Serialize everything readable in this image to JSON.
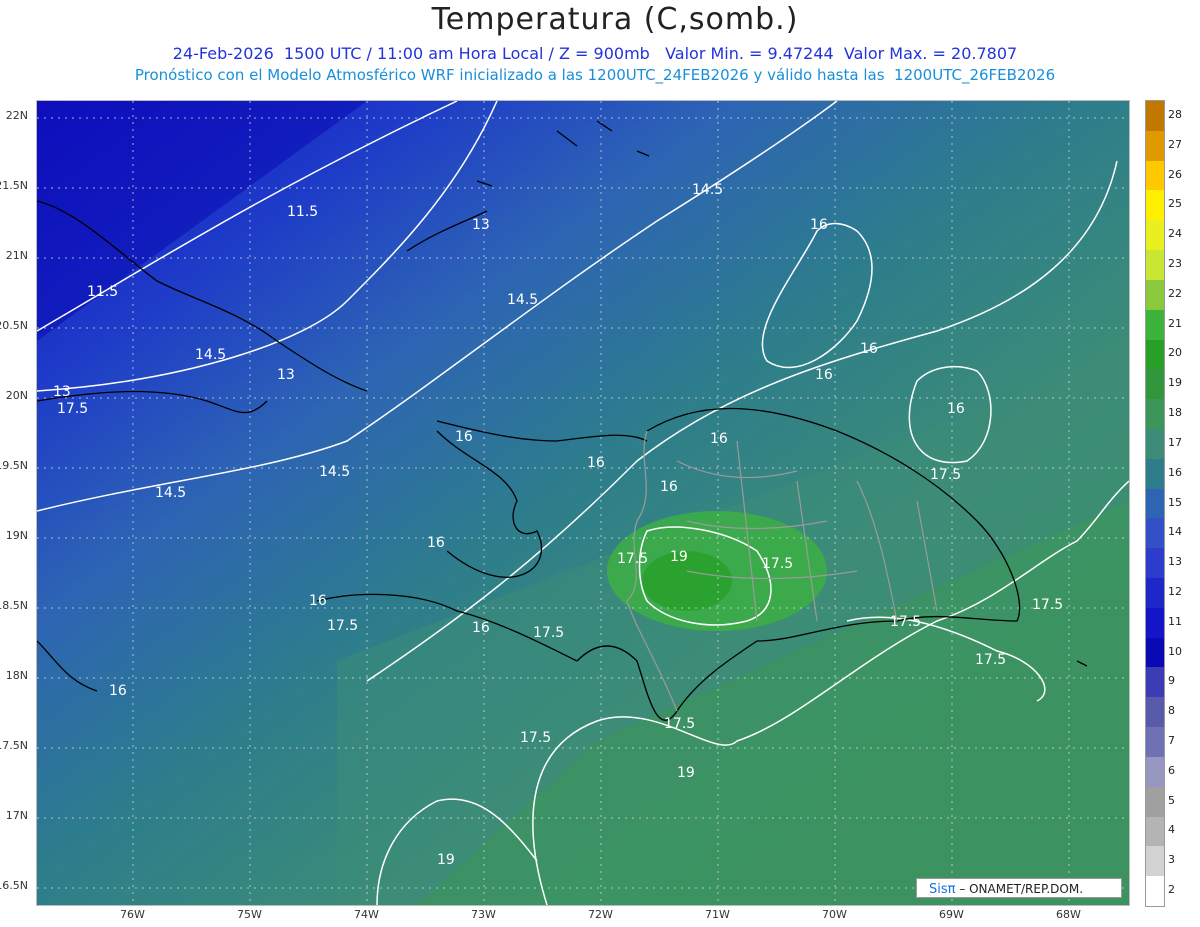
{
  "header": {
    "title": "Temperatura (C,somb.)",
    "line1": "24-Feb-2026  1500 UTC / 11:00 am Hora Local / Z = 900mb   Valor Min. = 9.47244  Valor Max. = 20.7807",
    "line2": "Pronóstico con el Modelo Atmosférico WRF inicializado a las 1200UTC_24FEB2026 y válido hasta las  1200UTC_26FEB2026"
  },
  "axes": {
    "lat_labels": [
      "22N",
      "21.5N",
      "21N",
      "20.5N",
      "20N",
      "19.5N",
      "19N",
      "18.5N",
      "18N",
      "17.5N",
      "17N",
      "16.5N"
    ],
    "lon_labels": [
      "76W",
      "75W",
      "74W",
      "73W",
      "72W",
      "71W",
      "70W",
      "69W",
      "68W"
    ]
  },
  "colorbar": {
    "labels": [
      "28",
      "27",
      "26",
      "25",
      "24",
      "23",
      "22",
      "21",
      "20",
      "19",
      "18",
      "17",
      "16",
      "15",
      "14",
      "13",
      "12",
      "11",
      "10",
      "9",
      "8",
      "7",
      "6",
      "5",
      "4",
      "3",
      "2"
    ],
    "colors": [
      "#c07800",
      "#e09a00",
      "#ffc800",
      "#fff000",
      "#e8f020",
      "#c8e632",
      "#8cc83c",
      "#3cb43c",
      "#28a028",
      "#32963c",
      "#3c965a",
      "#3c8c78",
      "#2d7d8c",
      "#2d64b4",
      "#3250c8",
      "#2d3ccd",
      "#1e28c8",
      "#1414c8",
      "#0a0ab4",
      "#3c3cb4",
      "#5a5aaa",
      "#7070b4",
      "#9696c0",
      "#a0a0a0",
      "#b4b4b4",
      "#d2d2d2",
      "#ffffff"
    ]
  },
  "contour_labels": [
    "11.5",
    "11.5",
    "13",
    "13",
    "13",
    "14.5",
    "14.5",
    "14.5",
    "14.5",
    "14.5",
    "16",
    "16",
    "16",
    "16",
    "16",
    "16",
    "16",
    "16",
    "16",
    "16",
    "16",
    "16",
    "17.5",
    "17.5",
    "17.5",
    "17.5",
    "17.5",
    "17.5",
    "17.5",
    "17.5",
    "17.5",
    "17.5",
    "17.5",
    "19",
    "19",
    "19"
  ],
  "credit": {
    "logo": "Sisπ",
    "text": "– ONAMET/REP.DOM."
  }
}
